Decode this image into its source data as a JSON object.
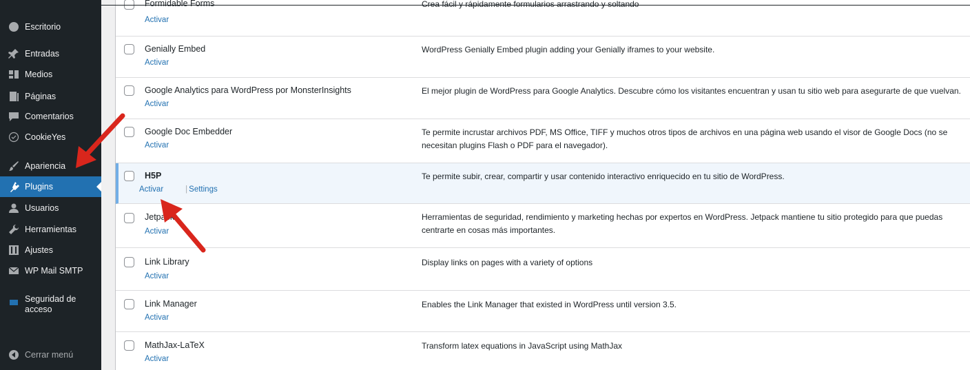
{
  "sidebar": {
    "items": [
      {
        "label": "Escritorio",
        "icon": "dashboard-icon"
      },
      {
        "label": "Entradas",
        "icon": "pin-icon"
      },
      {
        "label": "Medios",
        "icon": "media-icon"
      },
      {
        "label": "Páginas",
        "icon": "page-icon"
      },
      {
        "label": "Comentarios",
        "icon": "comment-icon"
      },
      {
        "label": "CookieYes",
        "icon": "cookie-icon"
      },
      {
        "label": "Apariencia",
        "icon": "brush-icon"
      },
      {
        "label": "Plugins",
        "icon": "plugin-icon"
      },
      {
        "label": "Usuarios",
        "icon": "user-icon"
      },
      {
        "label": "Herramientas",
        "icon": "wrench-icon"
      },
      {
        "label": "Ajustes",
        "icon": "settings-icon"
      },
      {
        "label": "WP Mail SMTP",
        "icon": "mail-icon"
      },
      {
        "label": "Seguridad de acceso",
        "icon": "shield-icon"
      },
      {
        "label": "Cerrar menú",
        "icon": "collapse-icon"
      }
    ],
    "active": "Plugins"
  },
  "plugins": [
    {
      "name": "Formidable Forms",
      "action": "Activar",
      "description": "Crea fácil y rápidamente formularios arrastrando y soltando"
    },
    {
      "name": "Genially Embed",
      "action": "Activar",
      "description": "WordPress Genially Embed plugin adding your Genially iframes to your website."
    },
    {
      "name": "Google Analytics para WordPress por MonsterInsights",
      "action": "Activar",
      "description": "El mejor plugin de WordPress para Google Analytics. Descubre cómo los visitantes encuentran y usan tu sitio web para asegurarte de que vuelvan."
    },
    {
      "name": "Google Doc Embedder",
      "action": "Activar",
      "description": "Te permite incrustar archivos PDF, MS Office, TIFF y muchos otros tipos de archivos en una página web usando el visor de Google Docs (no se necesitan plugins Flash o PDF para el navegador)."
    },
    {
      "name": "H5P",
      "action": "Activar",
      "action2": "Settings",
      "description": "Te permite subir, crear, compartir y usar contenido interactivo enriquecido en tu sitio de WordPress."
    },
    {
      "name": "Jetpack",
      "action": "Activar",
      "description": "Herramientas de seguridad, rendimiento y marketing hechas por expertos en WordPress. Jetpack mantiene tu sitio protegido para que puedas centrarte en cosas más importantes."
    },
    {
      "name": "Link Library",
      "action": "Activar",
      "description": "Display links on pages with a variety of options"
    },
    {
      "name": "Link Manager",
      "action": "Activar",
      "description": "Enables the Link Manager that existed in WordPress until version 3.5."
    },
    {
      "name": "MathJax-LaTeX",
      "action": "Activar",
      "description": "Transform latex equations in JavaScript using MathJax"
    }
  ],
  "colors": {
    "sidebar_bg": "#1d2327",
    "active_bg": "#2271b1",
    "link": "#2271b1",
    "highlight_row": "#f0f6fc",
    "annotation_arrow": "#d9261c"
  }
}
